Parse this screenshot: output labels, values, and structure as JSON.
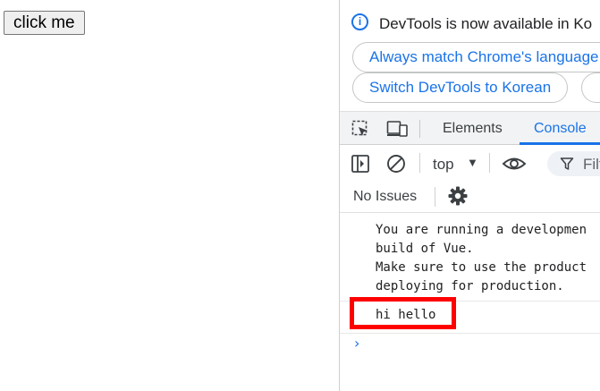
{
  "page": {
    "button_label": "click me"
  },
  "devtools": {
    "infobar": {
      "message": "DevTools is now available in Ko",
      "always_match": "Always match Chrome's language",
      "switch_korean": "Switch DevTools to Korean"
    },
    "tabs": {
      "elements": "Elements",
      "console": "Console"
    },
    "toolbar": {
      "context": "top",
      "filter": "Filt"
    },
    "issues": "No Issues",
    "console": {
      "vue_warning_lines": [
        "You are running a developmen",
        "build of Vue.",
        "Make sure to use the product",
        "deploying for production."
      ],
      "log_message": "hi hello"
    }
  },
  "colors": {
    "accent": "#1a73e8",
    "highlight": "#ff0000"
  }
}
